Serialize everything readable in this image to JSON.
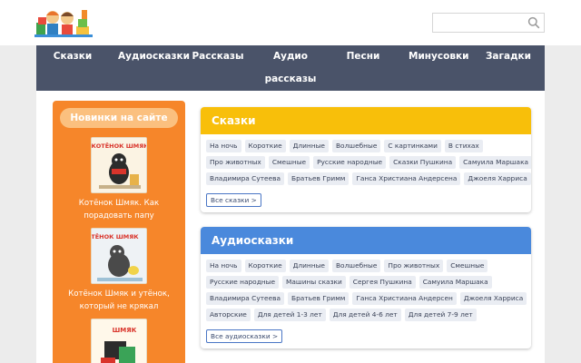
{
  "header": {
    "logo_alt": "",
    "search": {
      "placeholder": "",
      "value": ""
    }
  },
  "nav": {
    "items": [
      "Сказки",
      "Аудиосказки",
      "Рассказы",
      "Аудио рассказы",
      "Песни",
      "Минусовки",
      "Загадки"
    ]
  },
  "sidebar": {
    "title": "Новинки на сайте",
    "books": [
      {
        "caption": "Котёнок Шмяк. Как порадовать папу",
        "cover_title": "КОТЁНОК ШМЯК"
      },
      {
        "caption": "Котёнок Шмяк и утёнок, который не крякал",
        "cover_title": "КОТЁНОК ШМЯК"
      },
      {
        "caption": "",
        "cover_title": "ШМЯК"
      }
    ]
  },
  "cards": [
    {
      "title": "Сказки",
      "color": "#f8bf0a",
      "rows": [
        [
          "На ночь",
          "Короткие",
          "Длинные",
          "Волшебные",
          "С картинками",
          "В стихах"
        ],
        [
          "Про животных",
          "Смешные",
          "Русские народные",
          "Сказки Пушкина",
          "Самуила Маршака"
        ],
        [
          "Владимира Сутеева",
          "Братьев Гримм",
          "Ганса Христиана Андерсена",
          "Джоеля Харриса"
        ]
      ],
      "all_label": "Все сказки >"
    },
    {
      "title": "Аудиосказки",
      "color": "#4a89dc",
      "rows": [
        [
          "На ночь",
          "Короткие",
          "Длинные",
          "Волшебные",
          "Про животных",
          "Смешные"
        ],
        [
          "Русские народные",
          "Машины сказки",
          "Сергея Пушкина",
          "Самуила Маршака"
        ],
        [
          "Владимира Сутеева",
          "Братьев Гримм",
          "Ганса Христиана Андерсен",
          "Джоеля Харриса"
        ],
        [
          "Авторские",
          "Для детей 1-3 лет",
          "Для детей 4-6 лет",
          "Для детей 7-9 лет"
        ]
      ],
      "all_label": "Все аудиосказки >"
    }
  ]
}
